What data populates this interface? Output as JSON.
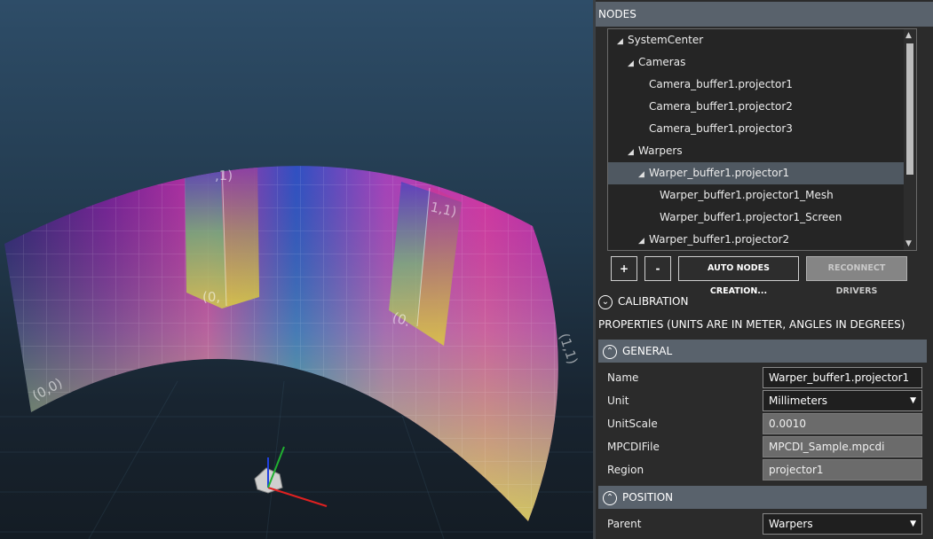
{
  "viewport": {
    "uv_labels": [
      "(0,0)",
      "(0,",
      "(0.",
      "(1,1)",
      ",1)",
      "1,1)"
    ]
  },
  "nodes_panel": {
    "header": "NODES",
    "tree": [
      {
        "label": "SystemCenter",
        "expanded": true
      },
      {
        "label": "Cameras",
        "expanded": true
      },
      {
        "label": "Camera_buffer1.projector1"
      },
      {
        "label": "Camera_buffer1.projector2"
      },
      {
        "label": "Camera_buffer1.projector3"
      },
      {
        "label": "Warpers",
        "expanded": true
      },
      {
        "label": "Warper_buffer1.projector1",
        "expanded": true,
        "selected": true
      },
      {
        "label": "Warper_buffer1.projector1_Mesh"
      },
      {
        "label": "Warper_buffer1.projector1_Screen"
      },
      {
        "label": "Warper_buffer1.projector2",
        "expanded": true
      }
    ],
    "buttons": {
      "add": "+",
      "remove": "-",
      "auto": "AUTO NODES CREATION...",
      "reconnect": "RECONNECT DRIVERS"
    }
  },
  "calibration": {
    "label": "CALIBRATION"
  },
  "properties": {
    "title": "PROPERTIES (UNITS ARE IN METER, ANGLES IN DEGREES)",
    "general": {
      "label": "GENERAL",
      "name_label": "Name",
      "name_value": "Warper_buffer1.projector1",
      "unit_label": "Unit",
      "unit_value": "Millimeters",
      "unitscale_label": "UnitScale",
      "unitscale_value": "0.0010",
      "mpcdi_label": "MPCDIFile",
      "mpcdi_value": "MPCDI_Sample.mpcdi",
      "region_label": "Region",
      "region_value": "projector1"
    },
    "position": {
      "label": "POSITION",
      "parent_label": "Parent",
      "parent_value": "Warpers"
    }
  },
  "colors": {
    "header_bg": "#59626c",
    "selection": "#4f5861",
    "panel_bg": "#2b2b2b",
    "axis_x": "#e02020",
    "axis_y": "#20b030",
    "axis_z": "#2040e0"
  }
}
